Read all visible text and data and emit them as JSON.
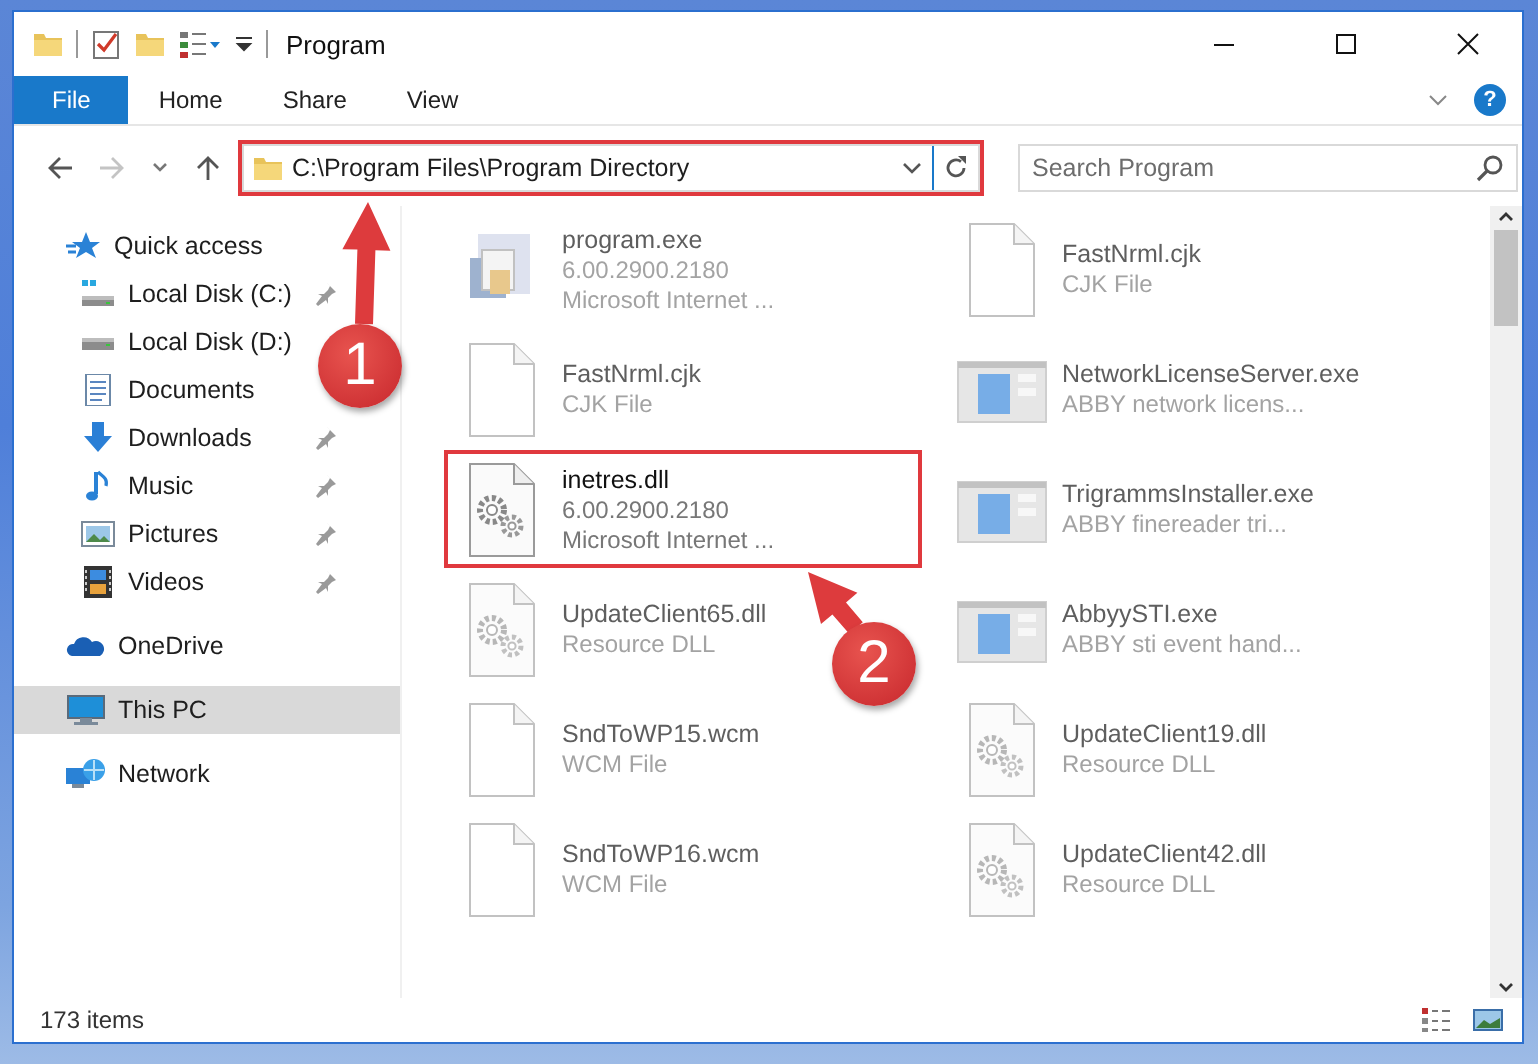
{
  "window": {
    "title": "Program"
  },
  "ribbon": {
    "tabs": [
      {
        "label": "File",
        "kind": "file",
        "selected": false
      },
      {
        "label": "Home",
        "kind": "tab",
        "selected": false
      },
      {
        "label": "Share",
        "kind": "tab",
        "selected": false
      },
      {
        "label": "View",
        "kind": "tab",
        "selected": false
      }
    ],
    "help_label": "?"
  },
  "address_bar": {
    "path": "C:\\Program Files\\Program Directory",
    "highlighted": true
  },
  "search": {
    "placeholder": "Search Program"
  },
  "sidebar": {
    "items": [
      {
        "label": "Quick access",
        "kind": "star",
        "selected": false,
        "children": [
          {
            "label": "Local Disk (C:)",
            "kind": "system-drive",
            "selected": false,
            "pinned": true
          },
          {
            "label": "Local Disk (D:)",
            "kind": "drive",
            "selected": false,
            "pinned": false
          },
          {
            "label": "Documents",
            "kind": "documents",
            "selected": false,
            "pinned": false
          },
          {
            "label": "Downloads",
            "kind": "downloads",
            "selected": false,
            "pinned": true
          },
          {
            "label": "Music",
            "kind": "music",
            "selected": false,
            "pinned": true
          },
          {
            "label": "Pictures",
            "kind": "pictures",
            "selected": false,
            "pinned": true
          },
          {
            "label": "Videos",
            "kind": "videos",
            "selected": false,
            "pinned": true
          }
        ]
      },
      {
        "label": "OneDrive",
        "kind": "cloud",
        "selected": false
      },
      {
        "label": "This PC",
        "kind": "computer",
        "selected": true
      },
      {
        "label": "Network",
        "kind": "network",
        "selected": false
      }
    ]
  },
  "files": [
    {
      "name": "program.exe",
      "details": [
        "6.00.2900.2180",
        "Microsoft Internet ..."
      ],
      "kind": "installer",
      "blurred": true,
      "highlighted": false
    },
    {
      "name": "FastNrml.cjk",
      "details": [
        "CJK File"
      ],
      "kind": "blank",
      "blurred": true,
      "highlighted": false
    },
    {
      "name": "FastNrml.cjk",
      "details": [
        "CJK File"
      ],
      "kind": "blank",
      "blurred": true,
      "highlighted": false
    },
    {
      "name": "NetworkLicenseServer.exe",
      "details": [
        "ABBY network licens..."
      ],
      "kind": "window",
      "blurred": true,
      "highlighted": false
    },
    {
      "name": "inetres.dll",
      "details": [
        "6.00.2900.2180",
        "Microsoft Internet ..."
      ],
      "kind": "gears",
      "blurred": false,
      "highlighted": true
    },
    {
      "name": "TrigrammsInstaller.exe",
      "details": [
        "ABBY finereader tri..."
      ],
      "kind": "window",
      "blurred": true,
      "highlighted": false
    },
    {
      "name": "UpdateClient65.dll",
      "details": [
        "Resource DLL"
      ],
      "kind": "gears",
      "blurred": true,
      "highlighted": false
    },
    {
      "name": "AbbyySTI.exe",
      "details": [
        "ABBY sti event hand..."
      ],
      "kind": "window",
      "blurred": true,
      "highlighted": false
    },
    {
      "name": "SndToWP15.wcm",
      "details": [
        "WCM File"
      ],
      "kind": "blank",
      "blurred": true,
      "highlighted": false
    },
    {
      "name": "UpdateClient19.dll",
      "details": [
        "Resource DLL"
      ],
      "kind": "gears",
      "blurred": true,
      "highlighted": false
    },
    {
      "name": "SndToWP16.wcm",
      "details": [
        "WCM File"
      ],
      "kind": "blank",
      "blurred": true,
      "highlighted": false
    },
    {
      "name": "UpdateClient42.dll",
      "details": [
        "Resource DLL"
      ],
      "kind": "gears",
      "blurred": true,
      "highlighted": false
    }
  ],
  "status_bar": {
    "item_count": "173 items"
  },
  "callouts": [
    {
      "number": "1"
    },
    {
      "number": "2"
    }
  ]
}
